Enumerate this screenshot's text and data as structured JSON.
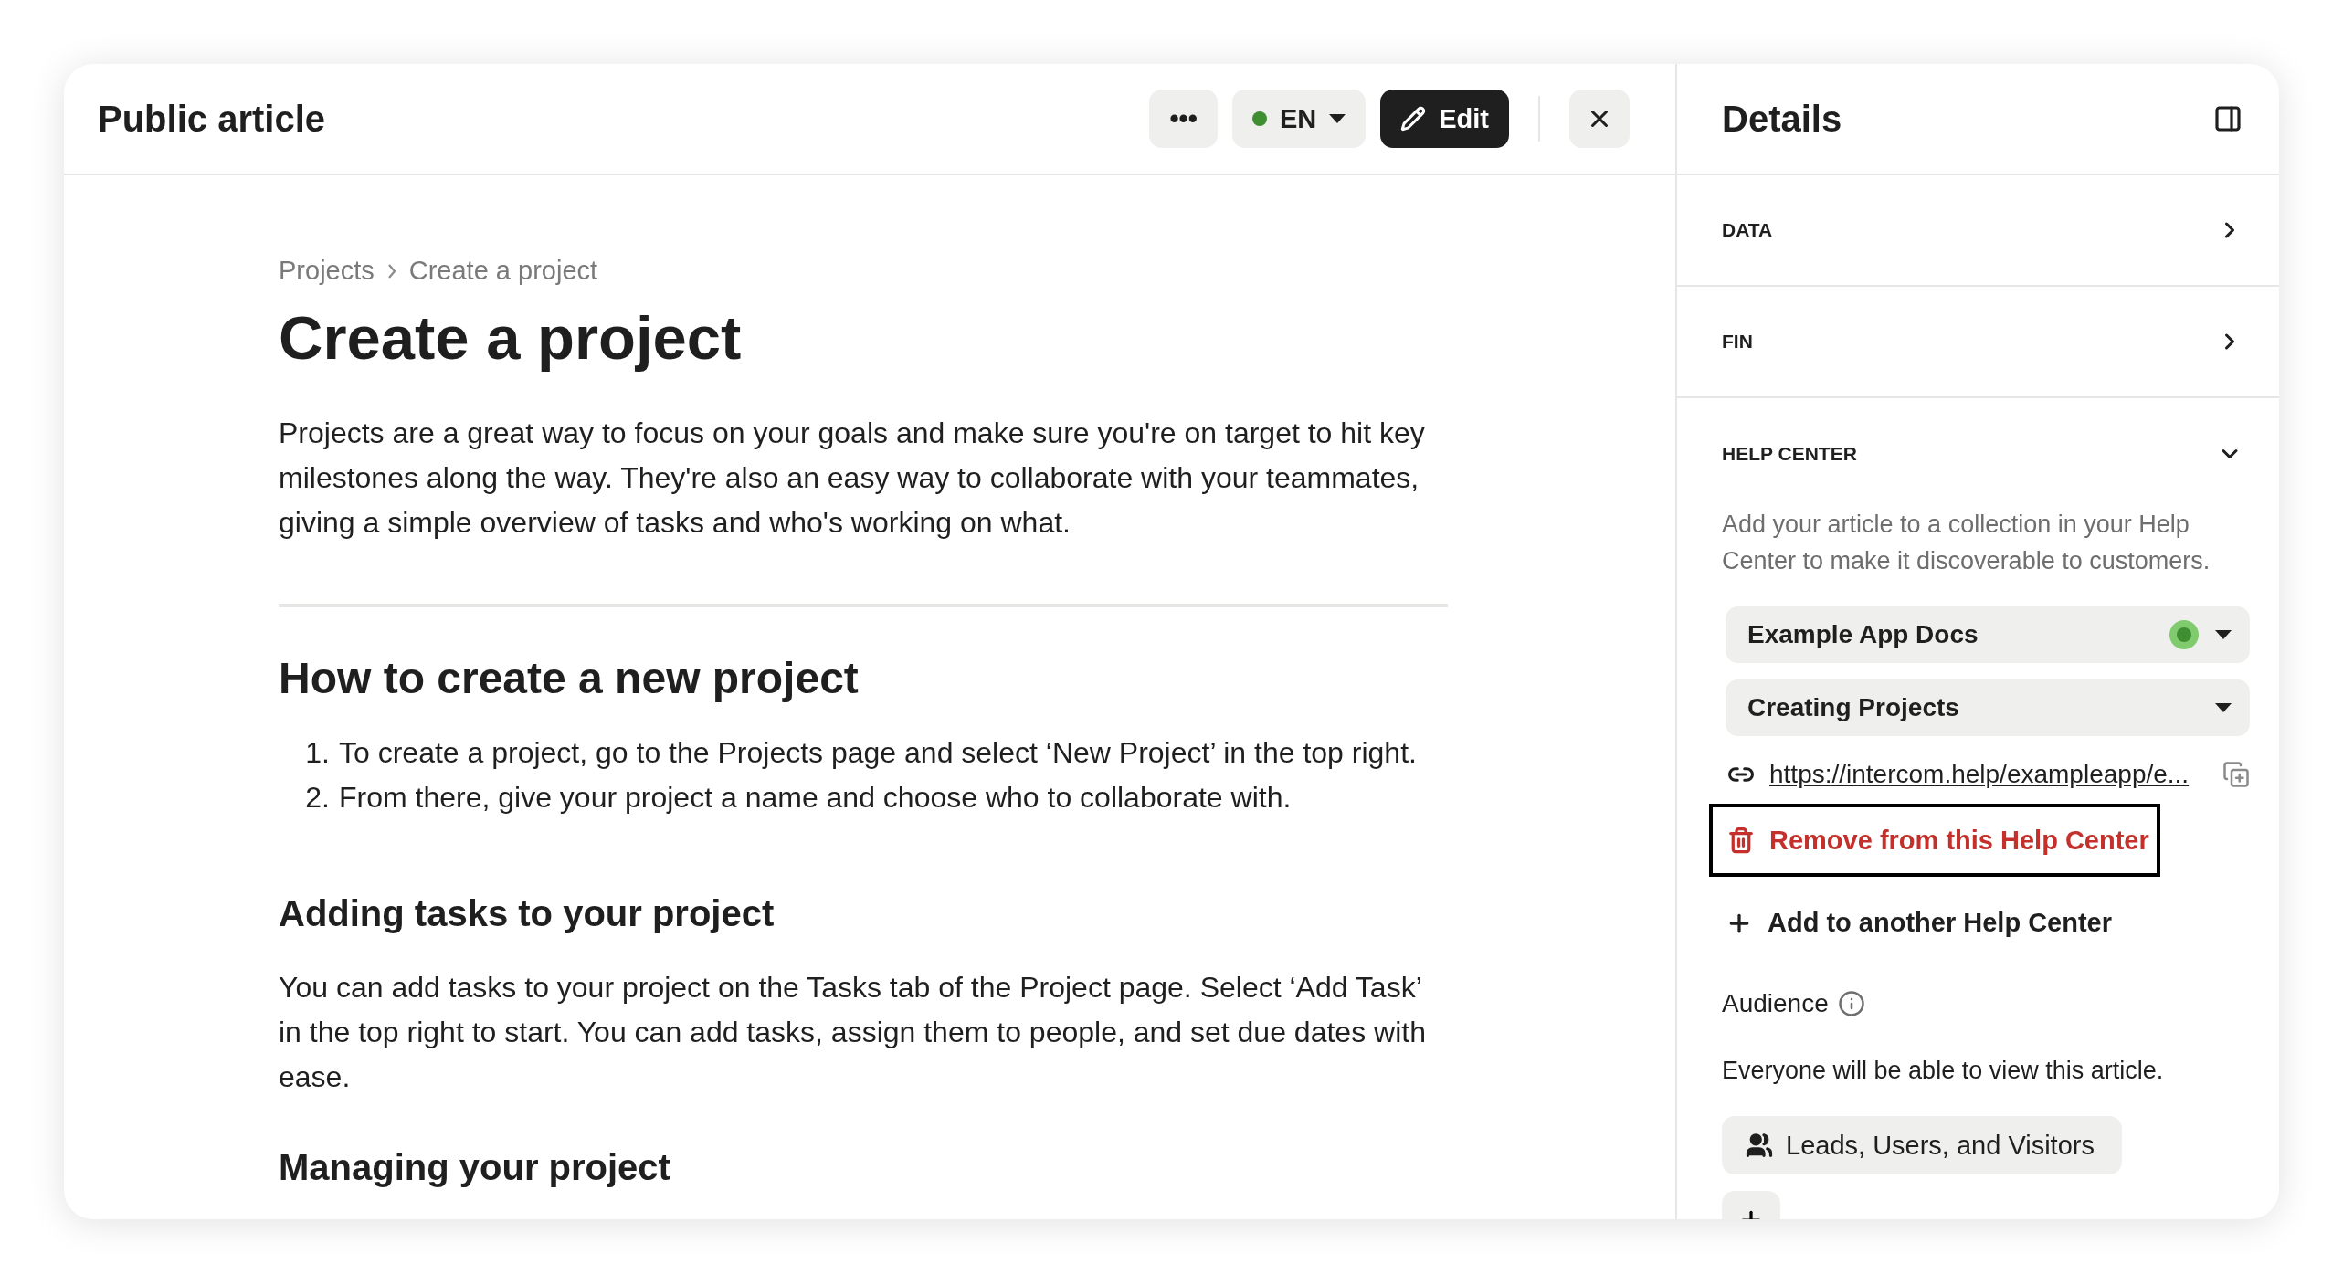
{
  "header": {
    "title": "Public article",
    "more_label": "•••",
    "language": {
      "label": "EN",
      "published": true
    },
    "edit_label": "Edit"
  },
  "article": {
    "breadcrumbs": [
      "Projects",
      "Create a project"
    ],
    "title": "Create a project",
    "blocks": [
      {
        "kind": "paragraph",
        "text": "Projects are a great way to focus on your goals and make sure you're on target to hit key milestones along the way. They're also an easy way to collaborate with your teammates, giving a simple overview of tasks and who's working on what."
      },
      {
        "kind": "divider"
      },
      {
        "kind": "h2",
        "text": "How to create a new project"
      },
      {
        "kind": "list",
        "items": [
          {
            "marker": "1.",
            "text": "To create a project, go to the Projects page and select ‘New Project’ in the top right."
          },
          {
            "marker": "2.",
            "text": "From there, give your project a name and choose who to collaborate with."
          }
        ]
      },
      {
        "kind": "h3",
        "text": "Adding tasks to your project"
      },
      {
        "kind": "paragraph",
        "text": "You can add tasks to your project on the Tasks tab of the Project page. Select ‘Add Task’ in the top right to start. You can add tasks, assign them to people, and set due dates with ease."
      },
      {
        "kind": "h3",
        "text": "Managing your project"
      }
    ]
  },
  "details": {
    "title": "Details",
    "sections": [
      {
        "label": "DATA",
        "expanded": false
      },
      {
        "label": "FIN",
        "expanded": false
      },
      {
        "label": "HELP CENTER",
        "expanded": true
      }
    ],
    "help_center": {
      "description": "Add your article to a collection in your Help Center to make it discoverable to customers.",
      "help_center_select": {
        "value": "Example App Docs",
        "published": true
      },
      "collection_select": {
        "value": "Creating Projects"
      },
      "url": "https://intercom.help/exampleapp/e...",
      "remove_label": "Remove from this Help Center",
      "remove_focused": true,
      "add_label": "Add to another Help Center"
    },
    "audience": {
      "label": "Audience",
      "description": "Everyone will be able to view this article.",
      "pill": "Leads, Users, and Visitors"
    }
  }
}
